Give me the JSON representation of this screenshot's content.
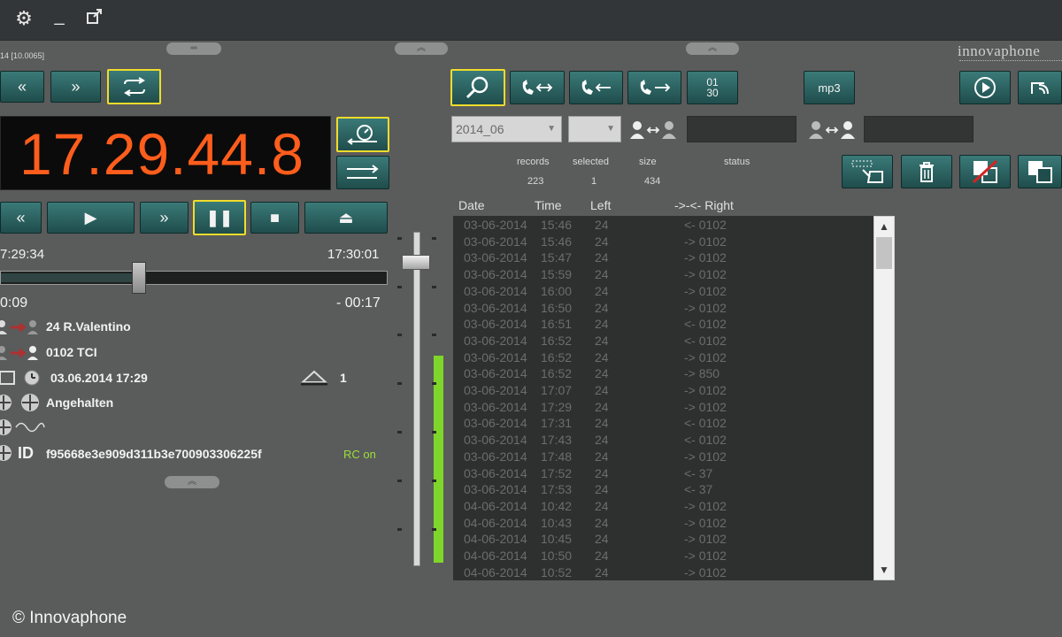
{
  "window": {
    "title_fragment": "14 [10.0065]"
  },
  "logo": {
    "text": "innovaphone"
  },
  "top_icons": [
    "gear-icon",
    "minimize-icon",
    "detach-icon"
  ],
  "clock": {
    "time": "17.29.44.8",
    "color": "#ff5d1c"
  },
  "player": {
    "start_time": "7:29:34",
    "end_time": "17:30:01",
    "elapsed": "0:09",
    "remaining": "- 00:17",
    "position_fraction": 0.35,
    "volume_fraction": 0.93,
    "level_fraction": 0.62
  },
  "call_info": {
    "caller": "24 R.Valentino",
    "callee": "0102 TCI",
    "datetime": "03.06.2014  17:29",
    "alarm_count": "1",
    "state": "Angehalten",
    "id_label": "ID",
    "id_value": "f95668e3e909d311b3e700903306225f",
    "rc_status": "RC on"
  },
  "filters": {
    "month": "2014_06",
    "second": ""
  },
  "buttons": {
    "mp3": "mp3",
    "sort_top": "01",
    "sort_bottom": "30"
  },
  "stats": {
    "labels": {
      "records": "records",
      "selected": "selected",
      "size": "size",
      "status": "status"
    },
    "values": {
      "records": "223",
      "selected": "1",
      "size": "434",
      "status": ""
    }
  },
  "table": {
    "headers": {
      "date": "Date",
      "time": "Time",
      "left": "Left",
      "right": "->-<- Right"
    },
    "rows": [
      {
        "date": "03-06-2014",
        "time": "15:46",
        "left": "24",
        "right": "<- 0102"
      },
      {
        "date": "03-06-2014",
        "time": "15:46",
        "left": "24",
        "right": "-> 0102"
      },
      {
        "date": "03-06-2014",
        "time": "15:47",
        "left": "24",
        "right": "-> 0102"
      },
      {
        "date": "03-06-2014",
        "time": "15:59",
        "left": "24",
        "right": "-> 0102"
      },
      {
        "date": "03-06-2014",
        "time": "16:00",
        "left": "24",
        "right": "-> 0102"
      },
      {
        "date": "03-06-2014",
        "time": "16:50",
        "left": "24",
        "right": "-> 0102"
      },
      {
        "date": "03-06-2014",
        "time": "16:51",
        "left": "24",
        "right": "<- 0102"
      },
      {
        "date": "03-06-2014",
        "time": "16:52",
        "left": "24",
        "right": "<- 0102"
      },
      {
        "date": "03-06-2014",
        "time": "16:52",
        "left": "24",
        "right": "-> 0102"
      },
      {
        "date": "03-06-2014",
        "time": "16:52",
        "left": "24",
        "right": "-> 850"
      },
      {
        "date": "03-06-2014",
        "time": "17:07",
        "left": "24",
        "right": "-> 0102"
      },
      {
        "date": "03-06-2014",
        "time": "17:29",
        "left": "24",
        "right": "-> 0102"
      },
      {
        "date": "03-06-2014",
        "time": "17:31",
        "left": "24",
        "right": "<- 0102"
      },
      {
        "date": "03-06-2014",
        "time": "17:43",
        "left": "24",
        "right": "<- 0102"
      },
      {
        "date": "03-06-2014",
        "time": "17:48",
        "left": "24",
        "right": "-> 0102"
      },
      {
        "date": "03-06-2014",
        "time": "17:52",
        "left": "24",
        "right": "<- 37"
      },
      {
        "date": "03-06-2014",
        "time": "17:53",
        "left": "24",
        "right": "<- 37"
      },
      {
        "date": "04-06-2014",
        "time": "10:42",
        "left": "24",
        "right": "-> 0102"
      },
      {
        "date": "04-06-2014",
        "time": "10:43",
        "left": "24",
        "right": "-> 0102"
      },
      {
        "date": "04-06-2014",
        "time": "10:45",
        "left": "24",
        "right": "-> 0102"
      },
      {
        "date": "04-06-2014",
        "time": "10:50",
        "left": "24",
        "right": "-> 0102"
      },
      {
        "date": "04-06-2014",
        "time": "10:52",
        "left": "24",
        "right": "-> 0102"
      }
    ]
  },
  "copyright": "© Innovaphone",
  "colors": {
    "accent_highlight": "#f1dc2b",
    "button_teal": "#2a6160",
    "level_green": "#7fd62a"
  }
}
